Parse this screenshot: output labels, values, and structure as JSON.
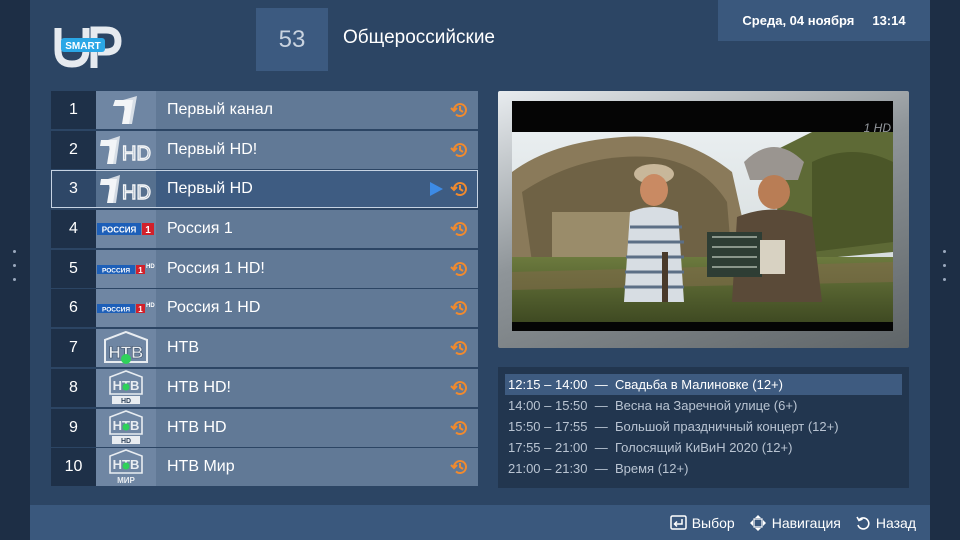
{
  "brand": {
    "logo_letters": "UP",
    "logo_badge": "SMART"
  },
  "category": {
    "number": "53",
    "title": "Общероссийские"
  },
  "clock": {
    "date": "Среда, 04 ноября",
    "time": "13:14"
  },
  "channels": [
    {
      "number": "1",
      "name": "Первый канал",
      "logo": "1"
    },
    {
      "number": "2",
      "name": "Первый HD!",
      "logo": "1HD"
    },
    {
      "number": "3",
      "name": "Первый HD",
      "logo": "1HD",
      "selected": true
    },
    {
      "number": "4",
      "name": "Россия 1",
      "logo": "РОССИЯ 1"
    },
    {
      "number": "5",
      "name": "Россия 1 HD!",
      "logo": "РОССИЯ 1 HD"
    },
    {
      "number": "6",
      "name": "Россия 1 HD",
      "logo": "РОССИЯ 1 HD"
    },
    {
      "number": "7",
      "name": "НТВ",
      "logo": "НТВ"
    },
    {
      "number": "8",
      "name": "НТВ HD!",
      "logo": "НТВ HD"
    },
    {
      "number": "9",
      "name": "НТВ HD",
      "logo": "НТВ HD"
    },
    {
      "number": "10",
      "name": "НТВ Мир",
      "logo": "НТВ МИР"
    }
  ],
  "preview": {
    "watermark": "1 HD"
  },
  "epg": [
    {
      "time": "12:15 – 14:00",
      "title": "Свадьба в Малиновке (12+)",
      "current": true
    },
    {
      "time": "14:00 – 15:50",
      "title": "Весна на Заречной улице (6+)"
    },
    {
      "time": "15:50 – 17:55",
      "title": "Большой праздничный концерт (12+)"
    },
    {
      "time": "17:55 – 21:00",
      "title": "Голосящий КиВиН 2020 (12+)"
    },
    {
      "time": "21:00 – 21:30",
      "title": "Время (12+)"
    }
  ],
  "footer": {
    "select": "Выбор",
    "navigate": "Навигация",
    "back": "Назад"
  },
  "colors": {
    "accent": "#f08a2e",
    "selected_bg": "#3e5c82",
    "panel": "#2c4564"
  }
}
